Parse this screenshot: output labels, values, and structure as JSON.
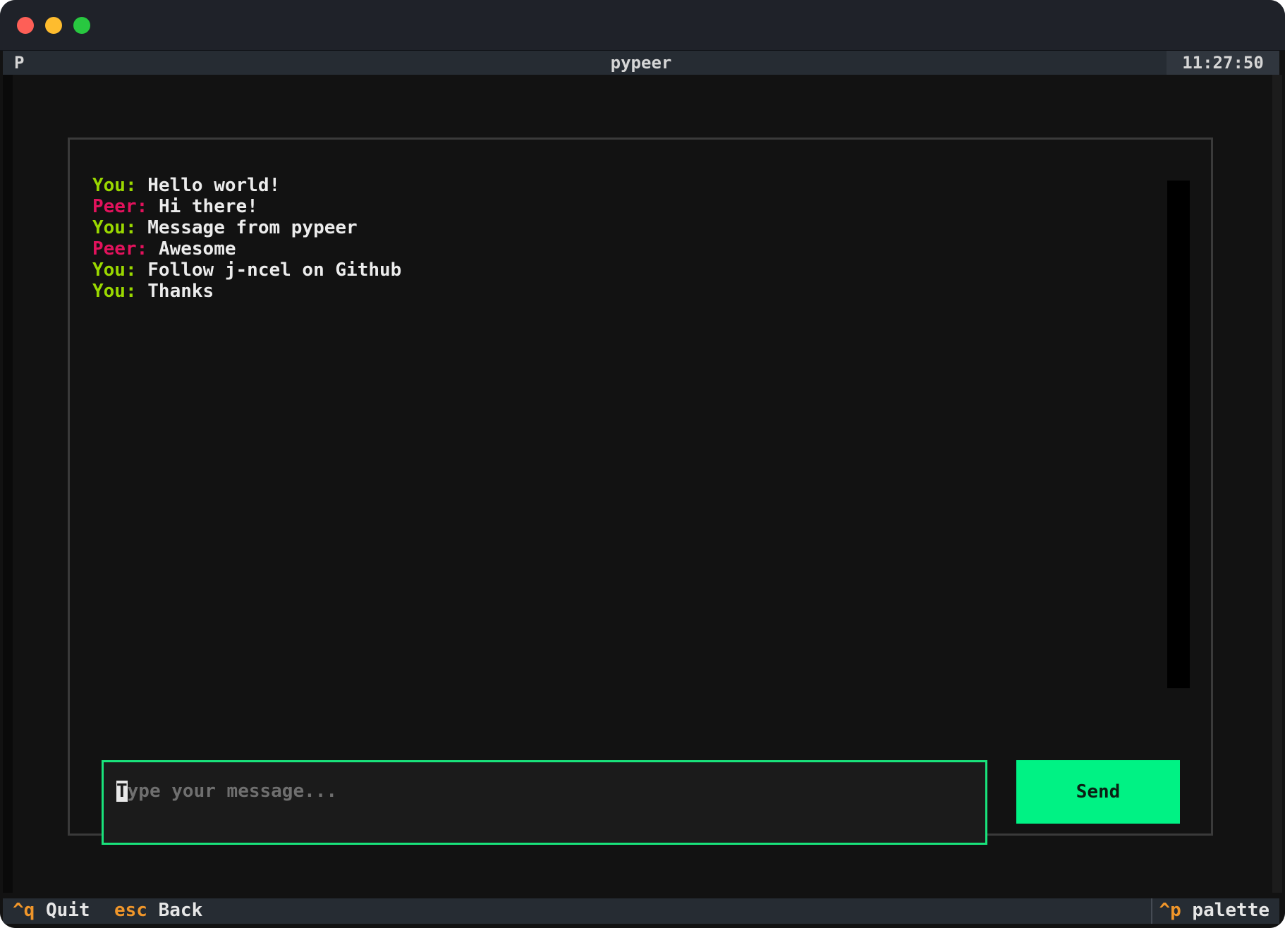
{
  "app": {
    "icon_letter": "P",
    "title": "pypeer",
    "clock": "11:27:50"
  },
  "messages": [
    {
      "sender": "You:",
      "type": "you",
      "text": "Hello world!"
    },
    {
      "sender": "Peer:",
      "type": "peer",
      "text": "Hi there!"
    },
    {
      "sender": "You:",
      "type": "you",
      "text": "Message from pypeer"
    },
    {
      "sender": "Peer:",
      "type": "peer",
      "text": "Awesome"
    },
    {
      "sender": "You:",
      "type": "you",
      "text": "Follow j-ncel on Github"
    },
    {
      "sender": "You:",
      "type": "you",
      "text": "Thanks"
    }
  ],
  "input": {
    "cursor_char": "T",
    "placeholder_rest": "ype your message...",
    "placeholder": "Type your message..."
  },
  "send_button": {
    "label": "Send"
  },
  "footer": {
    "quit_key": "^q",
    "quit_label": "Quit",
    "back_key": "esc",
    "back_label": "Back",
    "palette_key": "^p",
    "palette_label": "palette"
  },
  "colors": {
    "you": "#9ad800",
    "peer": "#e2125c",
    "accent": "#00f284",
    "input_border": "#19e37b",
    "key": "#f0962a"
  }
}
